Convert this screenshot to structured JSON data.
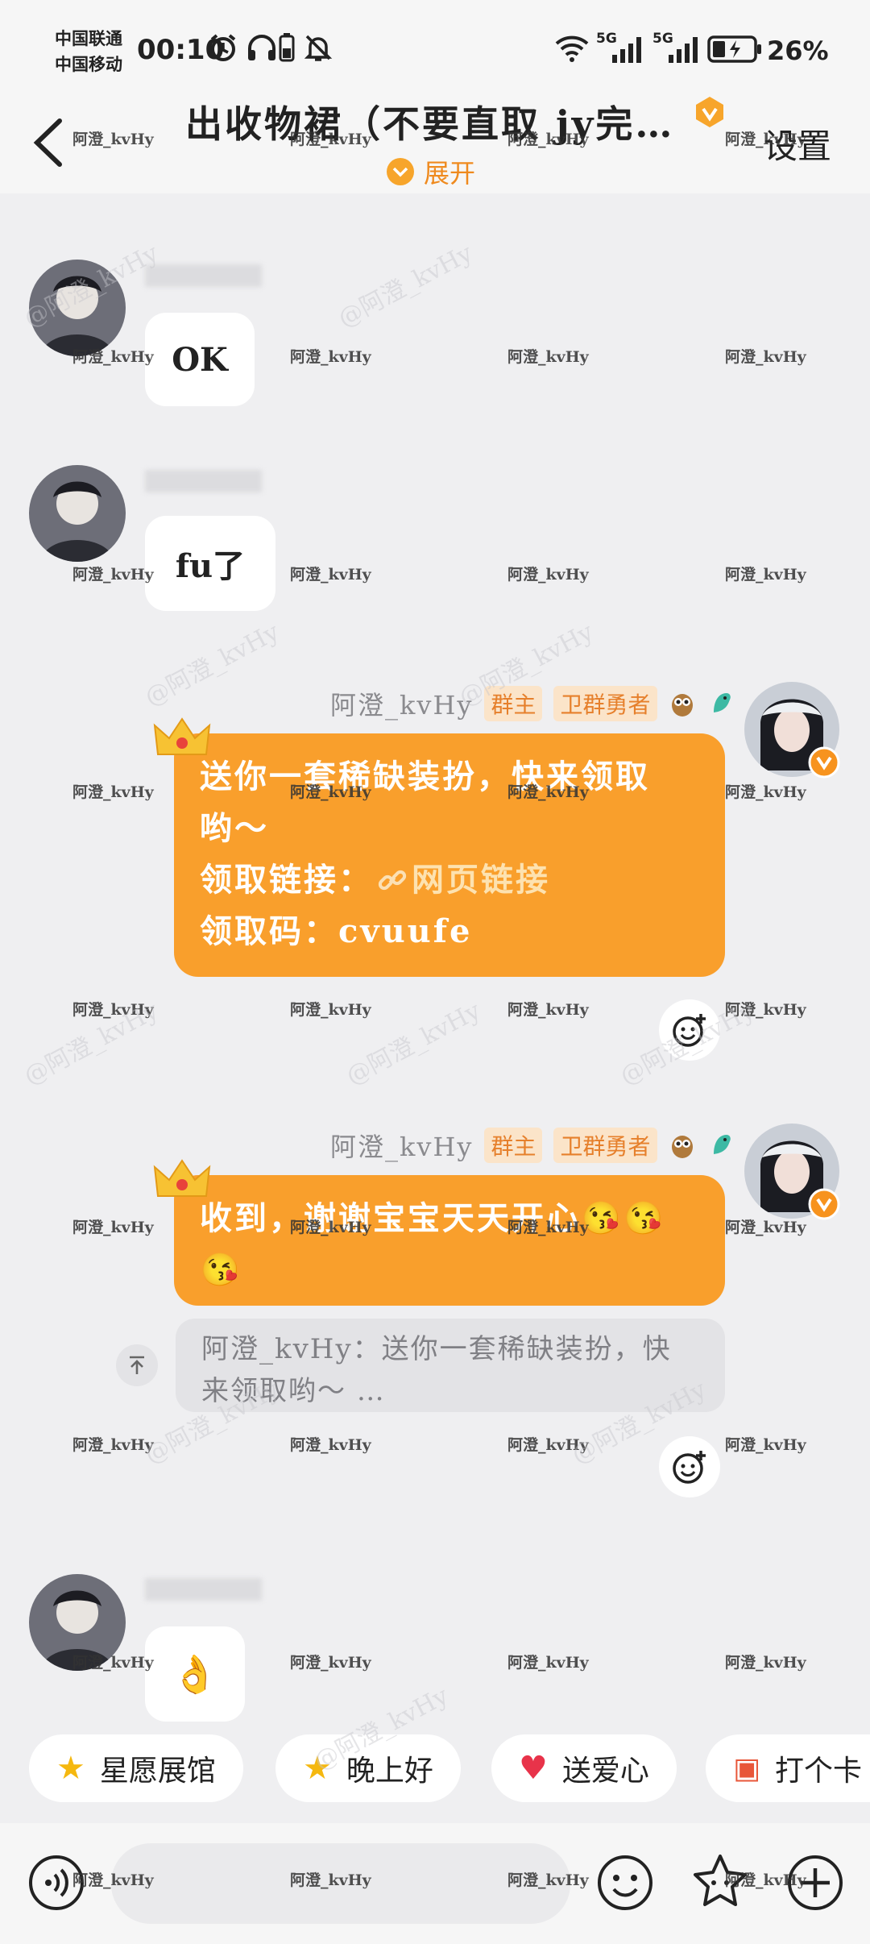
{
  "status_bar": {
    "carrier_1": "中国联通",
    "carrier_2": "中国移动",
    "time": "00:10",
    "signal_1": "5G",
    "signal_2": "5G",
    "battery": "26%"
  },
  "header": {
    "title": "出收物裙（不要直取 jy完…",
    "settings": "设置",
    "expand": "展开"
  },
  "messages": [
    {
      "side": "left",
      "text": "OK"
    },
    {
      "side": "left",
      "text": "fu了"
    },
    {
      "side": "right",
      "sender": "阿澄_kvHy",
      "tags": [
        "群主",
        "卫群勇者"
      ],
      "line_1": "送你一套稀缺装扮，快来领取",
      "line_2": "哟～",
      "link_label": "领取链接：",
      "link_text": "网页链接",
      "code_label": "领取码：",
      "code": "cvuufe"
    },
    {
      "side": "right",
      "sender": "阿澄_kvHy",
      "tags": [
        "群主",
        "卫群勇者"
      ],
      "text": "收到，谢谢宝宝天天开心",
      "quote_line_1": "阿澄_kvHy：送你一套稀缺装扮，快",
      "quote_line_2": "来领取哟～ …"
    },
    {
      "side": "left",
      "text": "👌"
    }
  ],
  "quick_chips": [
    "星愿展馆",
    "晚上好",
    "送爱心",
    "打个卡"
  ],
  "watermark": "阿澄_kvHy",
  "watermark_diag": "@阿澄_kvHy",
  "colors": {
    "accent": "#f99f2c",
    "tag_bg": "#fbe4c9",
    "tag_text": "#e6802c"
  }
}
